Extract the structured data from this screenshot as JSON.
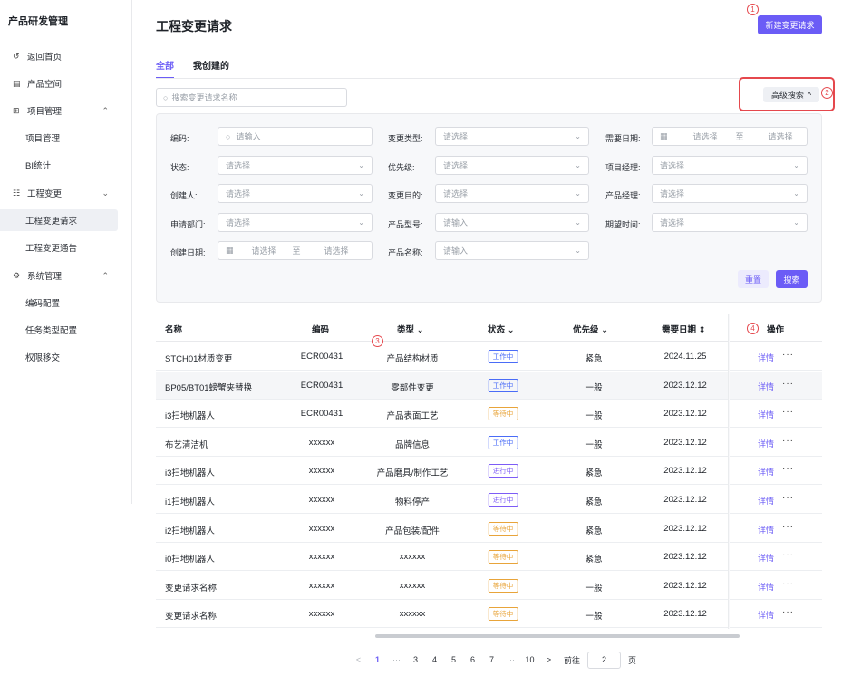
{
  "sidebar": {
    "brand": "产品研发管理",
    "items": [
      {
        "icon": "↺",
        "label": "返回首页",
        "chevron": ""
      },
      {
        "icon": "▤",
        "label": "产品空间",
        "chevron": ""
      },
      {
        "icon": "⊞",
        "label": "项目管理",
        "chevron": "⌃"
      },
      {
        "icon": "",
        "label": "项目管理",
        "chevron": ""
      },
      {
        "icon": "",
        "label": "BI统计",
        "chevron": ""
      },
      {
        "icon": "☷",
        "label": "工程变更",
        "chevron": "⌄"
      },
      {
        "icon": "",
        "label": "工程变更请求",
        "chevron": ""
      },
      {
        "icon": "",
        "label": "工程变更通告",
        "chevron": ""
      },
      {
        "icon": "⚙",
        "label": "系统管理",
        "chevron": "⌃"
      },
      {
        "icon": "",
        "label": "编码配置",
        "chevron": ""
      },
      {
        "icon": "",
        "label": "任务类型配置",
        "chevron": ""
      },
      {
        "icon": "",
        "label": "权限移交",
        "chevron": ""
      }
    ]
  },
  "header": {
    "title": "工程变更请求",
    "new_button": "新建变更请求"
  },
  "markers": [
    "1",
    "2",
    "3",
    "4"
  ],
  "tabs": [
    "全部",
    "我创建的"
  ],
  "search": {
    "placeholder": "搜索变更请求名称",
    "icon": "search-icon"
  },
  "advanced_search": {
    "label": "高级搜索",
    "chevron": "^"
  },
  "filters": {
    "code": {
      "label": "编码:",
      "placeholder": "请输入"
    },
    "change_type": {
      "label": "变更类型:",
      "placeholder": "请选择"
    },
    "required_date": {
      "label": "需要日期:",
      "start": "请选择",
      "sep": "至",
      "end": "请选择"
    },
    "status": {
      "label": "状态:",
      "placeholder": "请选择"
    },
    "priority": {
      "label": "优先级:",
      "placeholder": "请选择"
    },
    "project_manager": {
      "label": "项目经理:",
      "placeholder": "请选择"
    },
    "creator": {
      "label": "创建人:",
      "placeholder": "请选择"
    },
    "purpose": {
      "label": "变更目的:",
      "placeholder": "请选择"
    },
    "product_manager": {
      "label": "产品经理:",
      "placeholder": "请选择"
    },
    "department": {
      "label": "申请部门:",
      "placeholder": "请选择"
    },
    "model": {
      "label": "产品型号:",
      "placeholder": "请输入"
    },
    "expected_time": {
      "label": "期望时间:",
      "placeholder": "请选择"
    },
    "created_date": {
      "label": "创建日期:",
      "start": "请选择",
      "sep": "至",
      "end": "请选择"
    },
    "product_name": {
      "label": "产品名称:",
      "placeholder": "请输入"
    },
    "reset": "重置",
    "submit": "搜索"
  },
  "table": {
    "columns": {
      "name": "名称",
      "code": "编码",
      "type": "类型 ⌄",
      "status": "状态 ⌄",
      "priority": "优先级 ⌄",
      "date": "需要日期 ⇕",
      "ops": "操作"
    },
    "detail_label": "详情",
    "more_label": "···",
    "rows": [
      {
        "name": "STCH01材质变更",
        "code": "ECR00431",
        "type": "产品结构材质",
        "status": "工作中",
        "status_color": "blue",
        "priority": "紧急",
        "date": "2024.11.25"
      },
      {
        "name": "BP05/BT01螃蟹夹替换",
        "code": "ECR00431",
        "type": "零部件变更",
        "status": "工作中",
        "status_color": "blue",
        "priority": "一般",
        "date": "2023.12.12"
      },
      {
        "name": "i3扫地机器人",
        "code": "ECR00431",
        "type": "产品表面工艺",
        "status": "等待中",
        "status_color": "orange",
        "priority": "一般",
        "date": "2023.12.12"
      },
      {
        "name": "布艺清洁机",
        "code": "xxxxxx",
        "type": "品牌信息",
        "status": "工作中",
        "status_color": "blue",
        "priority": "一般",
        "date": "2023.12.12"
      },
      {
        "name": "i3扫地机器人",
        "code": "xxxxxx",
        "type": "产品磨具/制作工艺",
        "status": "进行中",
        "status_color": "purple",
        "priority": "紧急",
        "date": "2023.12.12"
      },
      {
        "name": "i1扫地机器人",
        "code": "xxxxxx",
        "type": "物料停产",
        "status": "进行中",
        "status_color": "purple",
        "priority": "紧急",
        "date": "2023.12.12"
      },
      {
        "name": "i2扫地机器人",
        "code": "xxxxxx",
        "type": "产品包装/配件",
        "status": "等待中",
        "status_color": "orange",
        "priority": "紧急",
        "date": "2023.12.12"
      },
      {
        "name": "i0扫地机器人",
        "code": "xxxxxx",
        "type": "xxxxxx",
        "status": "等待中",
        "status_color": "orange",
        "priority": "紧急",
        "date": "2023.12.12"
      },
      {
        "name": "变更请求名称",
        "code": "xxxxxx",
        "type": "xxxxxx",
        "status": "等待中",
        "status_color": "orange",
        "priority": "一般",
        "date": "2023.12.12"
      },
      {
        "name": "变更请求名称",
        "code": "xxxxxx",
        "type": "xxxxxx",
        "status": "等待中",
        "status_color": "orange",
        "priority": "一般",
        "date": "2023.12.12"
      }
    ]
  },
  "pagination": {
    "prev": "<",
    "pages": [
      "1",
      "···",
      "3",
      "4",
      "5",
      "6",
      "7",
      "···",
      "10"
    ],
    "current": "1",
    "next": ">",
    "goto_prefix": "前往",
    "goto_value": "2",
    "goto_suffix": "页"
  }
}
